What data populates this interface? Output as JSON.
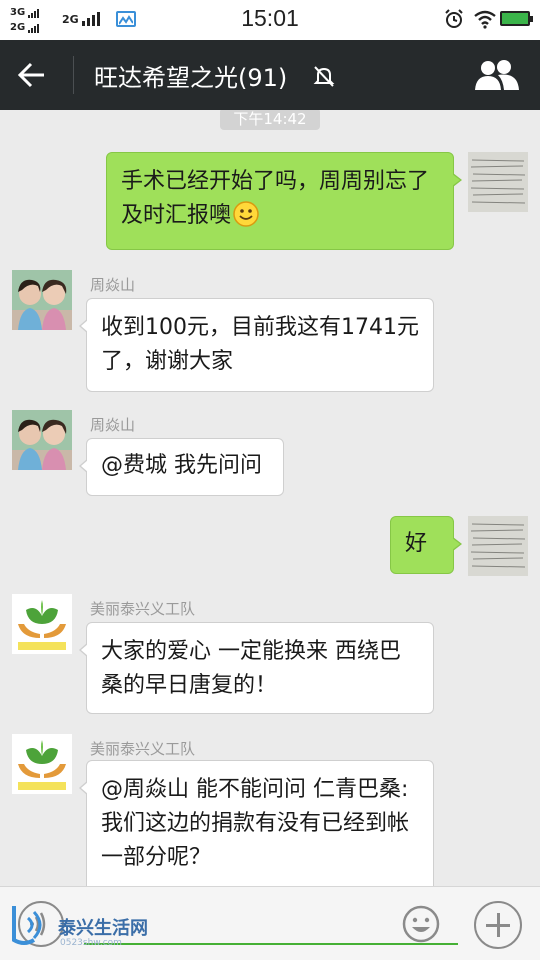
{
  "status_bar": {
    "sim1_label": "3G",
    "sim2_label": "2G",
    "net_label": "2G",
    "time": "15:01",
    "icons": [
      "signal-icon",
      "gallery-icon",
      "alarm-icon",
      "wifi-icon",
      "battery-charging-icon"
    ]
  },
  "header": {
    "title": "旺达希望之光(91)",
    "back_icon": "back-arrow-icon",
    "mute_icon": "mute-bell-icon",
    "group_icon": "group-members-icon"
  },
  "chat": {
    "timestamp": "下午14:42",
    "messages": [
      {
        "side": "right",
        "text": "手术已经开始了吗，周周别忘了及时汇报噢",
        "emoji": "smile-emoji-icon"
      },
      {
        "side": "left",
        "sender": "周焱山",
        "text": "收到100元，目前我这有1741元了，谢谢大家"
      },
      {
        "side": "left",
        "sender": "周焱山",
        "text": "@费城 我先问问"
      },
      {
        "side": "right",
        "text": "好"
      },
      {
        "side": "left",
        "sender": "美丽泰兴义工队",
        "text": "大家的爱心 一定能换来 西绕巴桑的早日唐复的！"
      },
      {
        "side": "left",
        "sender": "美丽泰兴义工队",
        "text": "@周焱山 能不能问问 仁青巴桑:我们这边的捐款有没有已经到帐一部分呢？"
      }
    ]
  },
  "input_bar": {
    "voice_icon": "voice-icon",
    "emoji_icon": "emoji-icon",
    "plus_icon": "plus-icon",
    "input_value": ""
  },
  "watermark": {
    "text": "泰兴生活网",
    "url": "0523shw.com"
  },
  "colors": {
    "title_bar": "#262a2c",
    "chat_bg": "#ebebeb",
    "sent_bubble": "#9fe05a",
    "received_bubble": "#ffffff",
    "input_underline": "#45b035"
  }
}
